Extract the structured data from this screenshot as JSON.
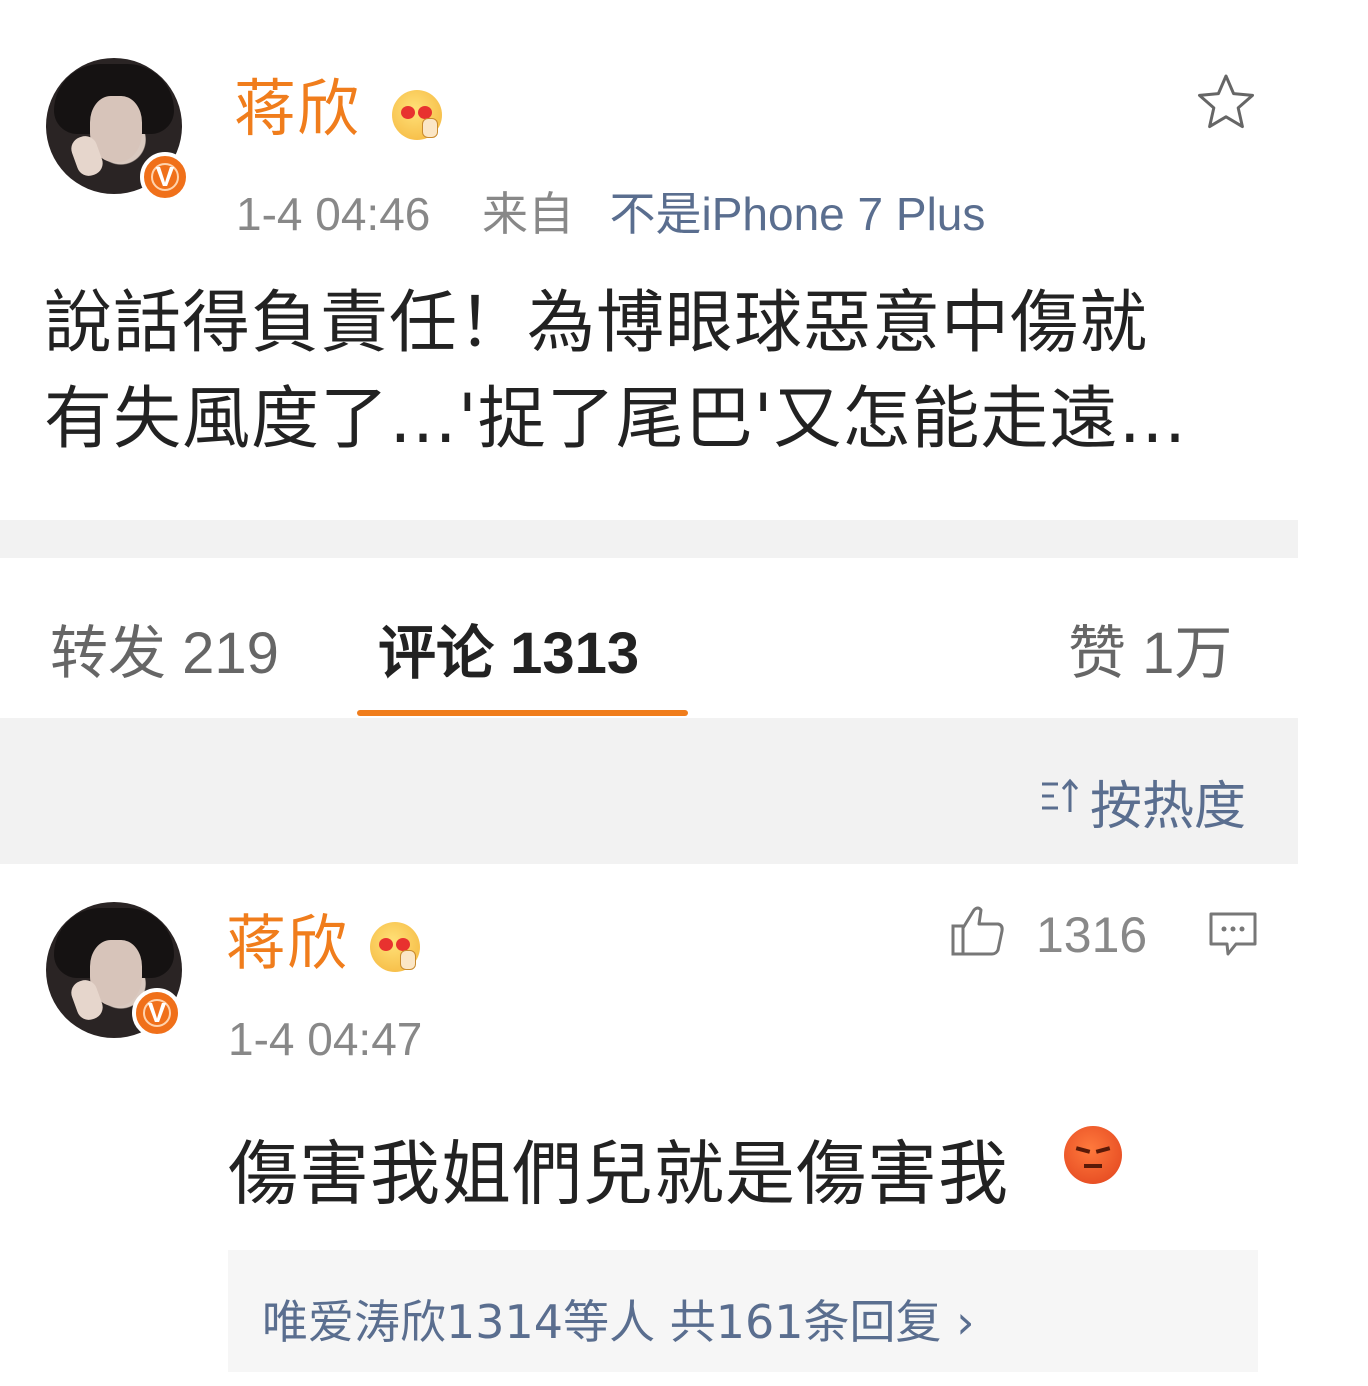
{
  "post": {
    "author": "蒋欣",
    "verified_badge": "V",
    "timestamp": "1-4 04:46",
    "source_prefix": "来自",
    "source": "不是iPhone 7 Plus",
    "text_line1": "說話得負責任！為博眼球惡意中傷就",
    "text_line2": "有失風度了…'捉了尾巴'又怎能走遠…",
    "favorite_icon": "star-icon"
  },
  "tabs": {
    "repost": "转发 219",
    "comments": "评论 1313",
    "likes": "赞 1万"
  },
  "sort": {
    "icon": "sort-icon",
    "label": "按热度"
  },
  "comment": {
    "author": "蒋欣",
    "verified_badge": "V",
    "timestamp": "1-4 04:47",
    "like_count": "1316",
    "text": "傷害我姐們兒就是傷害我",
    "emoji": "angry-face-emoji",
    "replies_summary": "唯爱涛欣1314等人 共161条回复 ›"
  },
  "colors": {
    "accent": "#f07d1c",
    "link": "#5a6e8f",
    "text": "#222222",
    "muted": "#888888",
    "band": "#f2f2f2"
  }
}
